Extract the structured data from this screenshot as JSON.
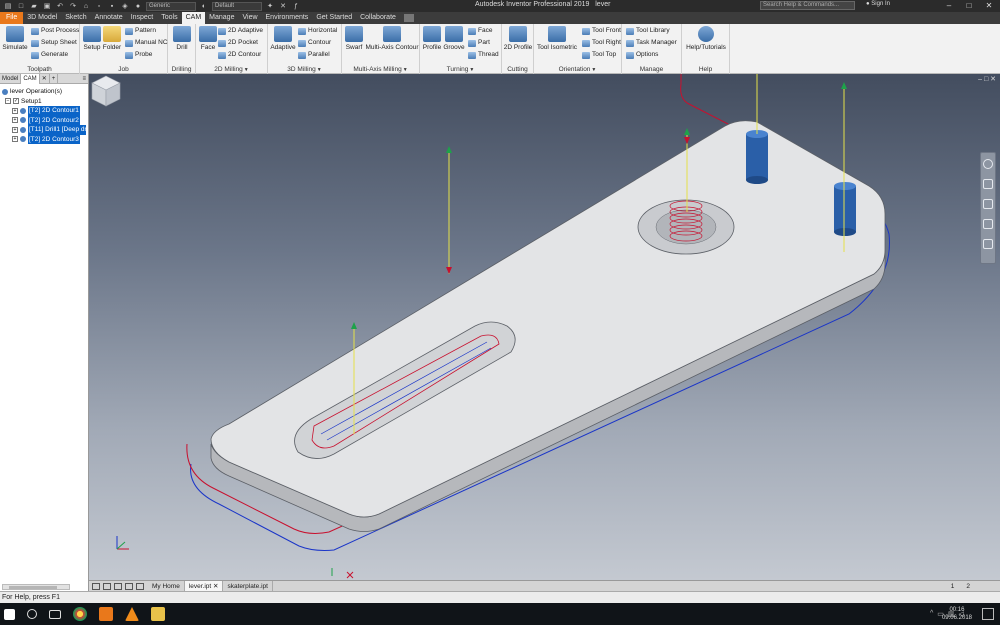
{
  "window": {
    "app_title": "Autodesk Inventor Professional 2019",
    "document_name": "lever",
    "search_placeholder": "Search Help & Commands...",
    "signin": "Sign In",
    "appearance_select": "Generic",
    "material_select": "Default"
  },
  "ribbon_tabs": [
    "File",
    "3D Model",
    "Sketch",
    "Annotate",
    "Inspect",
    "Tools",
    "CAM",
    "Manage",
    "View",
    "Environments",
    "Get Started",
    "Collaborate"
  ],
  "ribbon": {
    "toolpath": {
      "label": "Toolpath",
      "simulate": "Simulate",
      "post_process": "Post Process",
      "setup_sheet": "Setup Sheet",
      "generate": "Generate"
    },
    "job": {
      "label": "Job",
      "setup": "Setup",
      "folder": "Folder",
      "pattern": "Pattern",
      "manual_nc": "Manual NC",
      "probe": "Probe"
    },
    "drilling": {
      "label": "Drilling",
      "drill": "Drill"
    },
    "milling_2d": {
      "label": "2D Milling",
      "face": "Face",
      "adaptive": "2D Adaptive",
      "pocket": "2D Pocket",
      "contour": "2D Contour"
    },
    "milling_3d": {
      "label": "3D Milling",
      "adaptive": "Adaptive",
      "horizontal": "Horizontal",
      "contour": "Contour",
      "parallel": "Parallel"
    },
    "multi_axis": {
      "label": "Multi-Axis Milling",
      "swarf": "Swarf",
      "multi_axis_contour": "Multi-Axis Contour"
    },
    "turning": {
      "label": "Turning",
      "profile": "Profile",
      "groove": "Groove",
      "face": "Face",
      "part": "Part",
      "thread": "Thread"
    },
    "cutting": {
      "label": "Cutting",
      "profile_2d": "2D Profile"
    },
    "orientation": {
      "label": "Orientation",
      "tool_isometric": "Tool Isometric",
      "tool_front": "Tool Front",
      "tool_right": "Tool Right",
      "tool_top": "Tool Top"
    },
    "manage": {
      "label": "Manage",
      "tool_library": "Tool Library",
      "task_manager": "Task Manager",
      "options": "Options"
    },
    "help": {
      "label": "Help",
      "help_tutorials": "Help/Tutorials"
    }
  },
  "browser": {
    "tabs": [
      "Model",
      "CAM"
    ],
    "root": "lever Operation(s)",
    "setup": "Setup1",
    "operations": [
      "[T2] 2D Contour1",
      "[T2] 2D Contour2",
      "[T11] Drill1 [Deep drilling]",
      "[T2] 2D Contour3"
    ]
  },
  "document_tabs": [
    "My Home",
    "lever.ipt",
    "skaterplate.ipt"
  ],
  "page_numbers": [
    "1",
    "2"
  ],
  "status_text": "For Help, press F1",
  "taskbar": {
    "time": "00:16",
    "date": "09.06.2018"
  },
  "colors": {
    "accent_cam": "#e9781b",
    "selection": "#0a64c8",
    "toolpath_red": "#c8102e",
    "toolpath_blue": "#1a35c8",
    "axis_yellow": "#e4e14a"
  }
}
